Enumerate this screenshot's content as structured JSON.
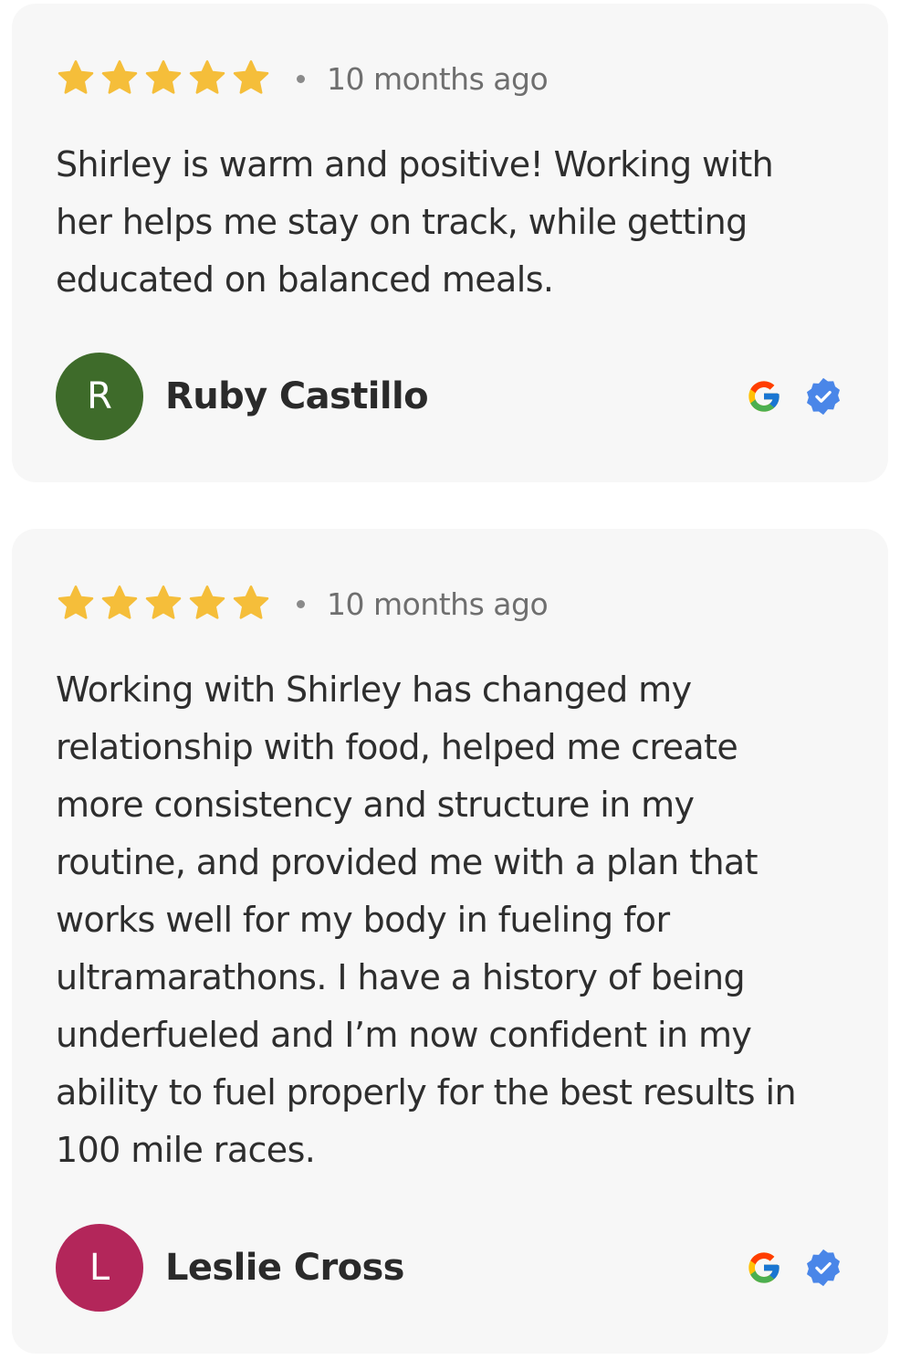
{
  "colors": {
    "star": "#F5BE3A",
    "card_background": "#F7F7F7",
    "verified_badge": "#4A86E8"
  },
  "reviews": [
    {
      "rating": 5,
      "time_ago": "10 months ago",
      "text_lines": [
        "Shirley is warm and positive! Working with",
        "her helps me stay on track, while getting",
        "educated on balanced meals."
      ],
      "author": {
        "initial": "R",
        "name": "Ruby Castillo",
        "avatar_color": "#3E6B2A"
      },
      "source_icon": "google-g-icon",
      "badge_icon": "verified-badge-icon"
    },
    {
      "rating": 5,
      "time_ago": "10 months ago",
      "text_lines": [
        "Working with Shirley has changed my",
        "relationship with food, helped me create",
        "more consistency and structure in my",
        "routine, and provided me with a plan that",
        "works well for my body in fueling for",
        "ultramarathons. I have a history of being",
        "underfueled and I’m now confident in my",
        "ability to fuel properly for the best results in",
        "100 mile races."
      ],
      "author": {
        "initial": "L",
        "name": "Leslie Cross",
        "avatar_color": "#B3265A"
      },
      "source_icon": "google-g-icon",
      "badge_icon": "verified-badge-icon"
    }
  ]
}
